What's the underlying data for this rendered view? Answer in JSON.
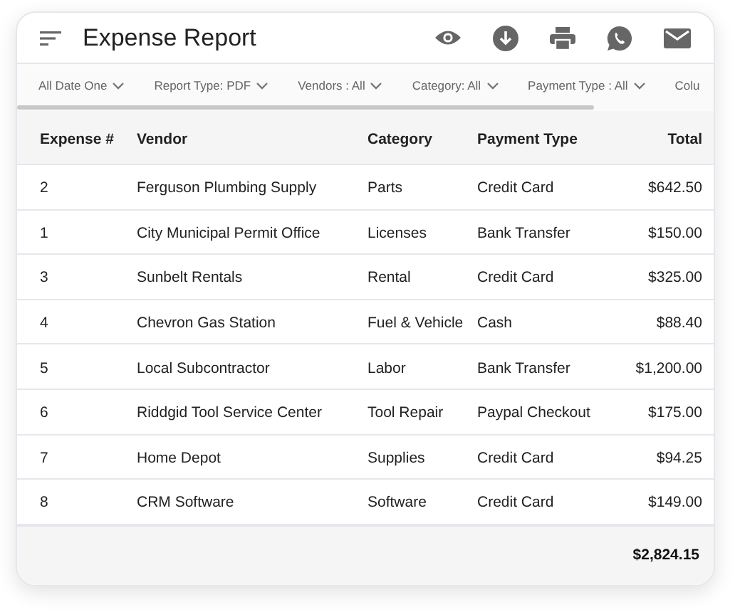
{
  "header": {
    "title": "Expense Report"
  },
  "filters": [
    {
      "label": "All Date One",
      "dropdown": true
    },
    {
      "label": "Report Type: PDF",
      "dropdown": true
    },
    {
      "label": "Vendors : All",
      "dropdown": true
    },
    {
      "label": "Category: All",
      "dropdown": true
    },
    {
      "label": "Payment Type : All",
      "dropdown": true
    },
    {
      "label": "Colu",
      "dropdown": false
    }
  ],
  "table": {
    "columns": [
      "Expense #",
      "Vendor",
      "Category",
      "Payment Type",
      "Total"
    ],
    "rows": [
      [
        "2",
        "Ferguson Plumbing Supply",
        "Parts",
        "Credit Card",
        "$642.50"
      ],
      [
        "1",
        "City Municipal Permit Office",
        "Licenses",
        "Bank Transfer",
        "$150.00"
      ],
      [
        "3",
        "Sunbelt Rentals",
        "Rental",
        "Credit Card",
        "$325.00"
      ],
      [
        "4",
        "Chevron Gas Station",
        "Fuel & Vehicle",
        "Cash",
        "$88.40"
      ],
      [
        "5",
        "Local Subcontractor",
        "Labor",
        "Bank Transfer",
        "$1,200.00"
      ],
      [
        "6",
        "Riddgid Tool Service Center",
        "Tool Repair",
        "Paypal Checkout",
        "$175.00"
      ],
      [
        "7",
        "Home Depot",
        "Supplies",
        "Credit Card",
        "$94.25"
      ],
      [
        "8",
        "CRM Software",
        "Software",
        "Credit Card",
        "$149.00"
      ]
    ],
    "total": "$2,824.15"
  }
}
